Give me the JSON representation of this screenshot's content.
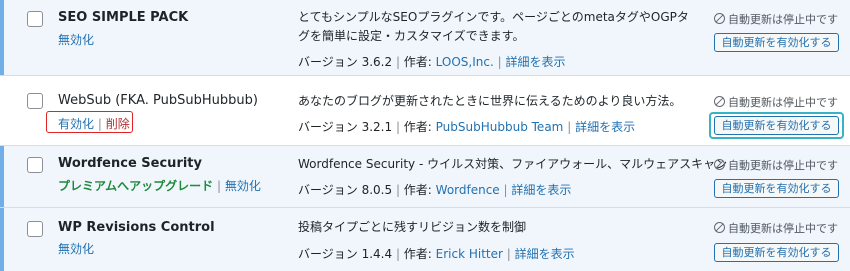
{
  "plugins": [
    {
      "name": "SEO SIMPLE PACK",
      "actions": [
        {
          "label": "無効化",
          "type": "deactivate"
        }
      ],
      "description": "とてもシンプルなSEOプラグインです。ページごとのmetaタグやOGPタグを簡単に設定・カスタマイズできます。",
      "version_text": "バージョン 3.6.2",
      "author_label": "作者:",
      "author": "LOOS,Inc.",
      "details": "詳細を表示",
      "au_status": "自動更新は停止中です",
      "au_button": "自動更新を有効化する"
    },
    {
      "name": "WebSub (FKA. PubSubHubbub)",
      "actions": [
        {
          "label": "有効化",
          "type": "activate"
        },
        {
          "label": "削除",
          "type": "delete"
        }
      ],
      "description": "あなたのブログが更新されたときに世界に伝えるためのより良い方法。",
      "version_text": "バージョン 3.2.1",
      "author_label": "作者:",
      "author": "PubSubHubbub Team",
      "details": "詳細を表示",
      "au_status": "自動更新は停止中です",
      "au_button": "自動更新を有効化する"
    },
    {
      "name": "Wordfence Security",
      "actions": [
        {
          "label": "プレミアムへアップグレード",
          "type": "upgrade"
        },
        {
          "label": "無効化",
          "type": "deactivate"
        }
      ],
      "description": "Wordfence Security - ウイルス対策、ファイアウォール、マルウェアスキャン",
      "version_text": "バージョン 8.0.5",
      "author_label": "作者:",
      "author": "Wordfence",
      "details": "詳細を表示",
      "au_status": "自動更新は停止中です",
      "au_button": "自動更新を有効化する"
    },
    {
      "name": "WP Revisions Control",
      "actions": [
        {
          "label": "無効化",
          "type": "deactivate"
        }
      ],
      "description": "投稿タイプごとに残すリビジョン数を制御",
      "version_text": "バージョン 1.4.4",
      "author_label": "作者:",
      "author": "Erick Hitter",
      "details": "詳細を表示",
      "au_status": "自動更新は停止中です",
      "au_button": "自動更新を有効化する"
    }
  ],
  "separator": "|",
  "colors": {
    "active_row_bg": "#f0f6fc",
    "active_border": "#72aee6",
    "link": "#2271b1",
    "upgrade": "#1e8a3c",
    "delete": "#b32d2e",
    "highlight_box": "#e02424",
    "focus_ring": "#38b3c5"
  }
}
